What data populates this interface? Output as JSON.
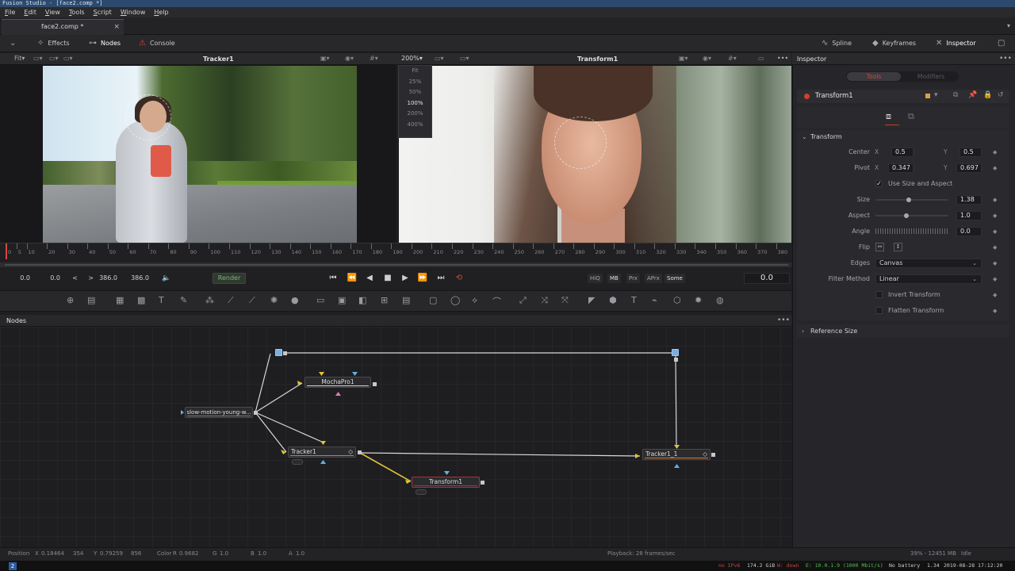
{
  "window": {
    "title": "Fusion Studio - [face2.comp *]"
  },
  "menu": [
    "File",
    "Edit",
    "View",
    "Tools",
    "Script",
    "Window",
    "Help"
  ],
  "doc_tab": {
    "label": "face2.comp *",
    "close": "×"
  },
  "toolbar": {
    "effects": "Effects",
    "nodes": "Nodes",
    "console": "Console",
    "spline": "Spline",
    "keyframes": "Keyframes",
    "inspector": "Inspector"
  },
  "viewer_left": {
    "title": "Tracker1",
    "fit": "Fit"
  },
  "viewer_right": {
    "title": "Transform1",
    "zoom": "200%",
    "zoom_options": [
      "Fit",
      "25%",
      "50%",
      "100%",
      "200%",
      "400%"
    ],
    "zoom_hover": "100%"
  },
  "ruler": {
    "labels": [
      "0",
      "5",
      "10",
      "20",
      "30",
      "40",
      "50",
      "60",
      "70",
      "80",
      "90",
      "100",
      "110",
      "120",
      "130",
      "140",
      "150",
      "160",
      "170",
      "180",
      "190",
      "200",
      "210",
      "220",
      "230",
      "240",
      "250",
      "260",
      "270",
      "280",
      "290",
      "300",
      "310",
      "320",
      "330",
      "340",
      "350",
      "360",
      "370",
      "380"
    ]
  },
  "transport": {
    "start": "0.0",
    "render_start": "0.0",
    "render_end": "386.0",
    "end": "386.0",
    "render": "Render",
    "hiq": "HiQ",
    "mb": "MB",
    "prx": "Prx",
    "aprx": "APrx",
    "some": "Some",
    "current": "0.0",
    "prev_chev": "<",
    "next_chev": ">"
  },
  "nodes": {
    "panel_title": "Nodes",
    "more": "•••",
    "items": {
      "mocha": "MochaPro1",
      "loader": "slow-motion-young-w...",
      "tracker": "Tracker1",
      "transform": "Transform1",
      "tracker2": "Tracker1_1"
    }
  },
  "inspector": {
    "title": "Inspector",
    "more": "•••",
    "tabs": {
      "tools": "Tools",
      "modifiers": "Modifiers"
    },
    "tool_name": "Transform1",
    "section": "Transform",
    "center": {
      "label": "Center",
      "x_lbl": "X",
      "x": "0.5",
      "y_lbl": "Y",
      "y": "0.5"
    },
    "pivot": {
      "label": "Pivot",
      "x_lbl": "X",
      "x": "0.347",
      "y_lbl": "Y",
      "y": "0.697"
    },
    "use_size_aspect": "Use Size and Aspect",
    "size": {
      "label": "Size",
      "value": "1.38",
      "level": 0.46
    },
    "aspect": {
      "label": "Aspect",
      "value": "1.0",
      "level": 0.42
    },
    "angle": {
      "label": "Angle",
      "value": "0.0"
    },
    "flip": "Flip",
    "edges": {
      "label": "Edges",
      "value": "Canvas"
    },
    "filter": {
      "label": "Filter Method",
      "value": "Linear"
    },
    "invert": "Invert Transform",
    "flatten": "Flatten Transform",
    "reference": "Reference Size"
  },
  "status": {
    "position_lbl": "Position",
    "x_lbl": "X",
    "x": "0.18464",
    "x_px": "354",
    "y_lbl": "Y",
    "y": "0.79259",
    "y_px": "856",
    "color_lbl": "Color",
    "r_lbl": "R",
    "r": "0.9682",
    "g_lbl": "G",
    "g": "1.0",
    "b_lbl": "B",
    "b": "1.0",
    "a_lbl": "A",
    "a": "1.0",
    "playback": "Playback: 28 frames/sec",
    "mem": "39% - 12451 MB",
    "state": "Idle"
  },
  "taskbar": {
    "workspace": "2",
    "ipv6": "no IPv6",
    "disk": "174.2 GiB",
    "wifi": "W: down",
    "eth": "E: 10.0.1.9 (1000 Mbit/s)",
    "battery": "No battery",
    "load": "1.34",
    "datetime": "2019-08-28 17:12:20"
  },
  "colors": {
    "accent_red": "#d24a3a",
    "node_orange": "#d07a32",
    "wire_yellow": "#e0c23a",
    "blue_port": "#7aaee0"
  }
}
